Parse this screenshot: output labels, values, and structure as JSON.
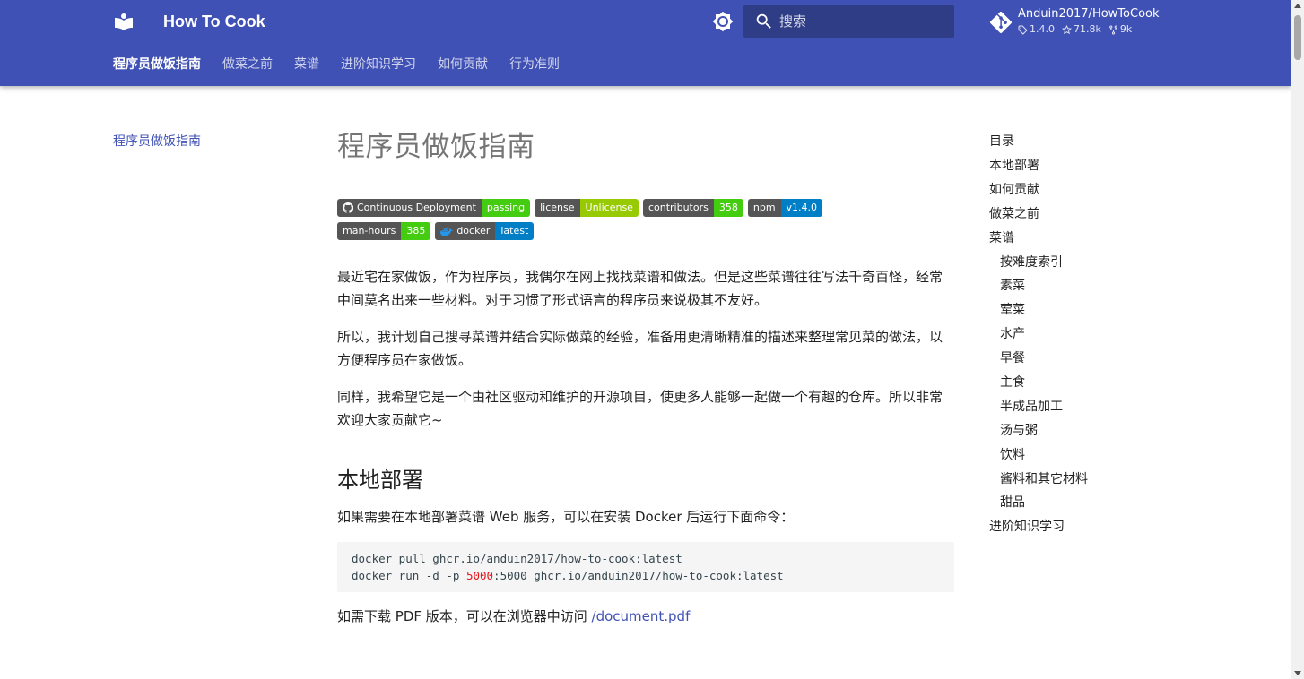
{
  "header": {
    "site_title": "How To Cook",
    "search_placeholder": "搜索",
    "repo": {
      "name": "Anduin2017/HowToCook",
      "version": "1.4.0",
      "stars": "71.8k",
      "forks": "9k"
    },
    "tabs": [
      {
        "label": "程序员做饭指南",
        "active": true
      },
      {
        "label": "做菜之前"
      },
      {
        "label": "菜谱"
      },
      {
        "label": "进阶知识学习"
      },
      {
        "label": "如何贡献"
      },
      {
        "label": "行为准则"
      }
    ],
    "colors": {
      "primary": "#4051b5"
    }
  },
  "nav": {
    "current": "程序员做饭指南"
  },
  "content": {
    "title": "程序员做饭指南",
    "badges": [
      {
        "label": "Continuous Deployment",
        "value": "passing",
        "color": "#4c1",
        "icon": "github-icon"
      },
      {
        "label": "license",
        "value": "Unlicense",
        "color": "#97ca00"
      },
      {
        "label": "contributors",
        "value": "358",
        "color": "#4c1"
      },
      {
        "label": "npm",
        "value": "v1.4.0",
        "color": "#007ec6"
      },
      {
        "label": "man-hours",
        "value": "385",
        "color": "#4c1"
      },
      {
        "label": "docker",
        "value": "latest",
        "color": "#007ec6",
        "icon": "docker-icon"
      }
    ],
    "paragraphs": [
      "最近宅在家做饭，作为程序员，我偶尔在网上找找菜谱和做法。但是这些菜谱往往写法千奇百怪，经常中间莫名出来一些材料。对于习惯了形式语言的程序员来说极其不友好。",
      "所以，我计划自己搜寻菜谱并结合实际做菜的经验，准备用更清晰精准的描述来整理常见菜的做法，以方便程序员在家做饭。",
      "同样，我希望它是一个由社区驱动和维护的开源项目，使更多人能够一起做一个有趣的仓库。所以非常欢迎大家贡献它~"
    ],
    "section_title": "本地部署",
    "deploy_text": "如果需要在本地部署菜谱 Web 服务，可以在安装 Docker 后运行下面命令：",
    "code_line1": "docker pull ghcr.io/anduin2017/how-to-cook:latest",
    "code_line2_a": "docker run -d -p ",
    "code_line2_port": "5000",
    "code_line2_b": ":5000 ghcr.io/anduin2017/how-to-cook:latest",
    "pdf_text": "如需下载 PDF 版本，可以在浏览器中访问 ",
    "pdf_link": "/document.pdf"
  },
  "toc": {
    "title": "目录",
    "items": [
      {
        "label": "本地部署",
        "level": 1
      },
      {
        "label": "如何贡献",
        "level": 1
      },
      {
        "label": "做菜之前",
        "level": 1
      },
      {
        "label": "菜谱",
        "level": 1
      },
      {
        "label": "按难度索引",
        "level": 2
      },
      {
        "label": "素菜",
        "level": 2
      },
      {
        "label": "荤菜",
        "level": 2
      },
      {
        "label": "水产",
        "level": 2
      },
      {
        "label": "早餐",
        "level": 2
      },
      {
        "label": "主食",
        "level": 2
      },
      {
        "label": "半成品加工",
        "level": 2
      },
      {
        "label": "汤与粥",
        "level": 2
      },
      {
        "label": "饮料",
        "level": 2
      },
      {
        "label": "酱料和其它材料",
        "level": 2
      },
      {
        "label": "甜品",
        "level": 2
      },
      {
        "label": "进阶知识学习",
        "level": 1
      }
    ]
  }
}
